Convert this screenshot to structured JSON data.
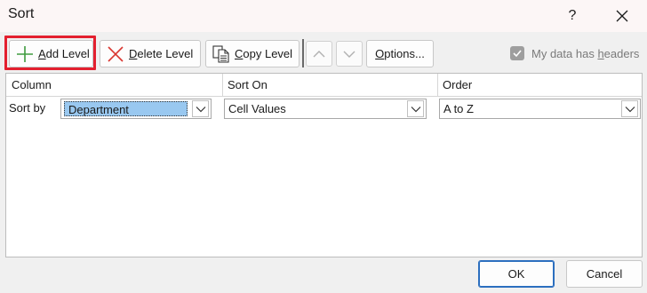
{
  "window": {
    "title": "Sort",
    "help_label": "?"
  },
  "toolbar": {
    "add_level_label": "Add Level",
    "add_level_mnemonic": "A",
    "add_level_rest": "dd Level",
    "delete_level_mnemonic": "D",
    "delete_level_rest": "elete Level",
    "copy_level_mnemonic": "C",
    "copy_level_rest": "opy Level",
    "options_mnemonic": "O",
    "options_rest": "ptions...",
    "my_data_has_headers_pre": "My data has ",
    "my_data_has_headers_mnemonic": "h",
    "my_data_has_headers_post": "eaders",
    "my_data_has_headers_checked": true,
    "accent_color": "#e3202f"
  },
  "grid": {
    "columns": [
      "Column",
      "Sort On",
      "Order"
    ],
    "rows": [
      {
        "label": "Sort by",
        "column": "Department",
        "sort_on": "Cell Values",
        "order": "A to Z"
      }
    ]
  },
  "buttons": {
    "ok": "OK",
    "cancel": "Cancel"
  }
}
